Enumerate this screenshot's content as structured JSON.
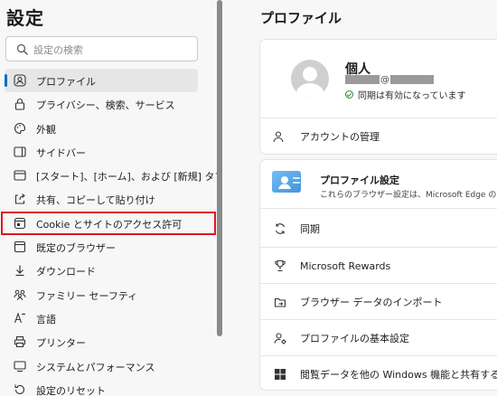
{
  "sidebar": {
    "title": "設定",
    "search_placeholder": "設定の検索",
    "items": [
      {
        "label": "プロファイル",
        "icon": "profile-icon"
      },
      {
        "label": "プライバシー、検索、サービス",
        "icon": "lock-icon"
      },
      {
        "label": "外観",
        "icon": "appearance-icon"
      },
      {
        "label": "サイドバー",
        "icon": "sidebar-icon"
      },
      {
        "label": "[スタート]、[ホーム]、および [新規] タブ",
        "icon": "home-tab-icon"
      },
      {
        "label": "共有、コピーして貼り付け",
        "icon": "share-icon"
      },
      {
        "label": "Cookie とサイトのアクセス許可",
        "icon": "cookie-icon"
      },
      {
        "label": "既定のブラウザー",
        "icon": "browser-icon"
      },
      {
        "label": "ダウンロード",
        "icon": "download-icon"
      },
      {
        "label": "ファミリー セーフティ",
        "icon": "family-icon"
      },
      {
        "label": "言語",
        "icon": "language-icon"
      },
      {
        "label": "プリンター",
        "icon": "printer-icon"
      },
      {
        "label": "システムとパフォーマンス",
        "icon": "system-icon"
      },
      {
        "label": "設定のリセット",
        "icon": "reset-icon"
      }
    ]
  },
  "main": {
    "title": "プロファイル",
    "profile": {
      "name": "個人",
      "email_at": "@",
      "sync_status": "同期は有効になっています"
    },
    "account_manage": "アカウントの管理",
    "profile_settings": {
      "title": "プロファイル設定",
      "description": "これらのブラウザー設定は、Microsoft Edge のプロファ"
    },
    "rows": [
      {
        "label": "同期",
        "icon": "sync-icon"
      },
      {
        "label": "Microsoft Rewards",
        "icon": "trophy-icon"
      },
      {
        "label": "ブラウザー データのインポート",
        "icon": "import-icon"
      },
      {
        "label": "プロファイルの基本設定",
        "icon": "profile-preferences-icon"
      },
      {
        "label": "閲覧データを他の Windows 機能と共有する",
        "icon": "windows-icon"
      }
    ]
  },
  "colors": {
    "accent": "#0f6cbd",
    "highlight": "#e0161f",
    "success": "#2a8a3a"
  }
}
